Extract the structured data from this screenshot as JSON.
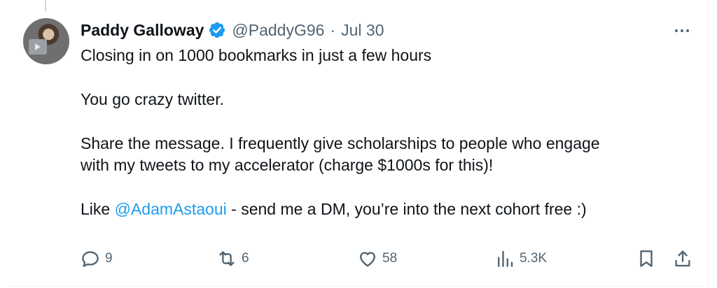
{
  "tweet": {
    "author_name": "Paddy Galloway",
    "handle": "@PaddyG96",
    "separator": "·",
    "date": "Jul 30",
    "text": {
      "line1": "Closing in on 1000 bookmarks in just a few hours",
      "line2": "You go crazy twitter.",
      "line3": "Share the message. I frequently give scholarships to people who engage",
      "line4": "with my tweets to my accelerator (charge $1000s for this)!",
      "line5_prefix": "Like ",
      "mention": "@AdamAstaoui",
      "line5_suffix": " - send me a DM, you’re into the next cohort free :)"
    }
  },
  "actions": {
    "replies": "9",
    "retweets": "6",
    "likes": "58",
    "views": "5.3K"
  },
  "icons": {
    "verified": "verified-badge-icon",
    "more": "more-icon",
    "reply": "reply-icon",
    "retweet": "retweet-icon",
    "like": "heart-icon",
    "views": "views-icon",
    "bookmark": "bookmark-icon",
    "share": "share-icon"
  },
  "colors": {
    "text": "#0f1419",
    "muted": "#536471",
    "link": "#1d9bf0",
    "verified": "#1d9bf0"
  }
}
